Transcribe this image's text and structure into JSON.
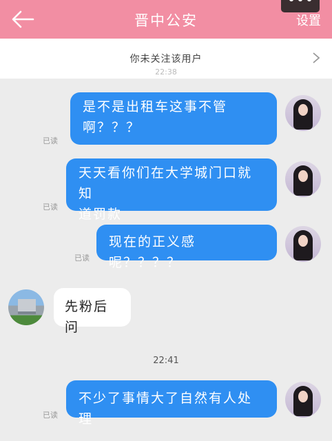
{
  "header": {
    "title": "晋中公安",
    "settings_label": "设置",
    "back_icon": "arrow-left-icon",
    "more_icon": "more-dots-icon",
    "color": "#f28ea3"
  },
  "follow_bar": {
    "text": "你未关注该用户",
    "chevron_icon": "chevron-right-icon"
  },
  "faded_time": "22:38",
  "messages": [
    {
      "direction": "out",
      "text_lines": [
        "是不是出租车这事不管",
        "啊？？？"
      ],
      "status": "已读"
    },
    {
      "direction": "out",
      "text_lines": [
        "天天看你们在大学城门口就知",
        "道罚款"
      ],
      "status": "已读"
    },
    {
      "direction": "out",
      "text_lines": [
        "现在的正义感呢？？？？"
      ],
      "status": "已读"
    },
    {
      "direction": "in",
      "text_lines": [
        "先粉后问"
      ]
    },
    {
      "direction": "out",
      "text_lines": [
        "不少了事情大了自然有人处理"
      ],
      "status": "已读"
    }
  ],
  "time_separator": "22:41",
  "colors": {
    "out_bubble": "#2f8ff2",
    "in_bubble": "#ffffff",
    "background": "#ececec"
  }
}
